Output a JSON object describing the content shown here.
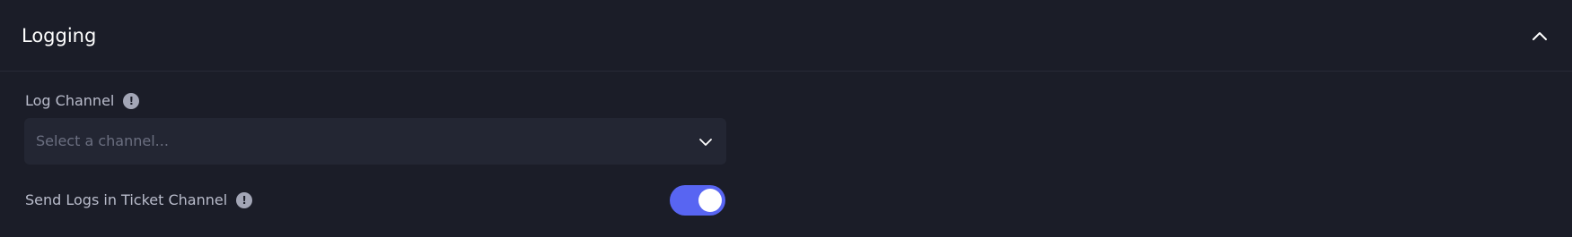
{
  "section": {
    "title": "Logging"
  },
  "log_channel": {
    "label": "Log Channel",
    "info_icon": "!",
    "placeholder": "Select a channel..."
  },
  "send_logs": {
    "label": "Send Logs in Ticket Channel",
    "info_icon": "!",
    "enabled": true
  },
  "colors": {
    "background": "#1b1d28",
    "input_background": "#232633",
    "toggle_on": "#5865f2"
  },
  "icons": {
    "collapse": "chevron-up-icon",
    "select": "chevron-down-icon",
    "info": "info-icon"
  }
}
